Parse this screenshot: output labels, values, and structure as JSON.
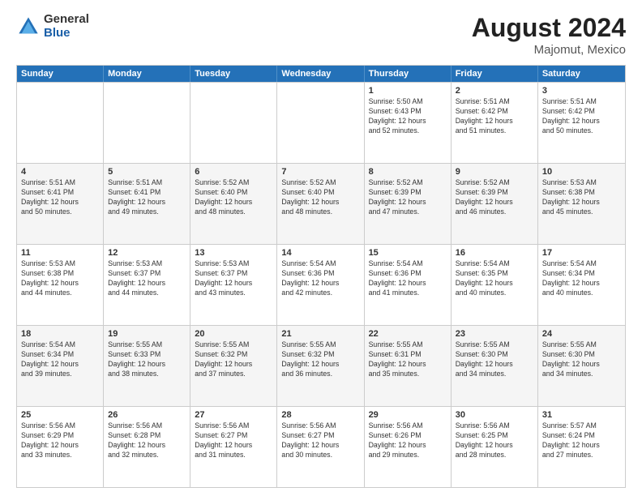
{
  "logo": {
    "general": "General",
    "blue": "Blue"
  },
  "header": {
    "month_year": "August 2024",
    "location": "Majomut, Mexico"
  },
  "weekdays": [
    "Sunday",
    "Monday",
    "Tuesday",
    "Wednesday",
    "Thursday",
    "Friday",
    "Saturday"
  ],
  "rows": [
    [
      {
        "day": "",
        "info": ""
      },
      {
        "day": "",
        "info": ""
      },
      {
        "day": "",
        "info": ""
      },
      {
        "day": "",
        "info": ""
      },
      {
        "day": "1",
        "info": "Sunrise: 5:50 AM\nSunset: 6:43 PM\nDaylight: 12 hours\nand 52 minutes."
      },
      {
        "day": "2",
        "info": "Sunrise: 5:51 AM\nSunset: 6:42 PM\nDaylight: 12 hours\nand 51 minutes."
      },
      {
        "day": "3",
        "info": "Sunrise: 5:51 AM\nSunset: 6:42 PM\nDaylight: 12 hours\nand 50 minutes."
      }
    ],
    [
      {
        "day": "4",
        "info": "Sunrise: 5:51 AM\nSunset: 6:41 PM\nDaylight: 12 hours\nand 50 minutes."
      },
      {
        "day": "5",
        "info": "Sunrise: 5:51 AM\nSunset: 6:41 PM\nDaylight: 12 hours\nand 49 minutes."
      },
      {
        "day": "6",
        "info": "Sunrise: 5:52 AM\nSunset: 6:40 PM\nDaylight: 12 hours\nand 48 minutes."
      },
      {
        "day": "7",
        "info": "Sunrise: 5:52 AM\nSunset: 6:40 PM\nDaylight: 12 hours\nand 48 minutes."
      },
      {
        "day": "8",
        "info": "Sunrise: 5:52 AM\nSunset: 6:39 PM\nDaylight: 12 hours\nand 47 minutes."
      },
      {
        "day": "9",
        "info": "Sunrise: 5:52 AM\nSunset: 6:39 PM\nDaylight: 12 hours\nand 46 minutes."
      },
      {
        "day": "10",
        "info": "Sunrise: 5:53 AM\nSunset: 6:38 PM\nDaylight: 12 hours\nand 45 minutes."
      }
    ],
    [
      {
        "day": "11",
        "info": "Sunrise: 5:53 AM\nSunset: 6:38 PM\nDaylight: 12 hours\nand 44 minutes."
      },
      {
        "day": "12",
        "info": "Sunrise: 5:53 AM\nSunset: 6:37 PM\nDaylight: 12 hours\nand 44 minutes."
      },
      {
        "day": "13",
        "info": "Sunrise: 5:53 AM\nSunset: 6:37 PM\nDaylight: 12 hours\nand 43 minutes."
      },
      {
        "day": "14",
        "info": "Sunrise: 5:54 AM\nSunset: 6:36 PM\nDaylight: 12 hours\nand 42 minutes."
      },
      {
        "day": "15",
        "info": "Sunrise: 5:54 AM\nSunset: 6:36 PM\nDaylight: 12 hours\nand 41 minutes."
      },
      {
        "day": "16",
        "info": "Sunrise: 5:54 AM\nSunset: 6:35 PM\nDaylight: 12 hours\nand 40 minutes."
      },
      {
        "day": "17",
        "info": "Sunrise: 5:54 AM\nSunset: 6:34 PM\nDaylight: 12 hours\nand 40 minutes."
      }
    ],
    [
      {
        "day": "18",
        "info": "Sunrise: 5:54 AM\nSunset: 6:34 PM\nDaylight: 12 hours\nand 39 minutes."
      },
      {
        "day": "19",
        "info": "Sunrise: 5:55 AM\nSunset: 6:33 PM\nDaylight: 12 hours\nand 38 minutes."
      },
      {
        "day": "20",
        "info": "Sunrise: 5:55 AM\nSunset: 6:32 PM\nDaylight: 12 hours\nand 37 minutes."
      },
      {
        "day": "21",
        "info": "Sunrise: 5:55 AM\nSunset: 6:32 PM\nDaylight: 12 hours\nand 36 minutes."
      },
      {
        "day": "22",
        "info": "Sunrise: 5:55 AM\nSunset: 6:31 PM\nDaylight: 12 hours\nand 35 minutes."
      },
      {
        "day": "23",
        "info": "Sunrise: 5:55 AM\nSunset: 6:30 PM\nDaylight: 12 hours\nand 34 minutes."
      },
      {
        "day": "24",
        "info": "Sunrise: 5:55 AM\nSunset: 6:30 PM\nDaylight: 12 hours\nand 34 minutes."
      }
    ],
    [
      {
        "day": "25",
        "info": "Sunrise: 5:56 AM\nSunset: 6:29 PM\nDaylight: 12 hours\nand 33 minutes."
      },
      {
        "day": "26",
        "info": "Sunrise: 5:56 AM\nSunset: 6:28 PM\nDaylight: 12 hours\nand 32 minutes."
      },
      {
        "day": "27",
        "info": "Sunrise: 5:56 AM\nSunset: 6:27 PM\nDaylight: 12 hours\nand 31 minutes."
      },
      {
        "day": "28",
        "info": "Sunrise: 5:56 AM\nSunset: 6:27 PM\nDaylight: 12 hours\nand 30 minutes."
      },
      {
        "day": "29",
        "info": "Sunrise: 5:56 AM\nSunset: 6:26 PM\nDaylight: 12 hours\nand 29 minutes."
      },
      {
        "day": "30",
        "info": "Sunrise: 5:56 AM\nSunset: 6:25 PM\nDaylight: 12 hours\nand 28 minutes."
      },
      {
        "day": "31",
        "info": "Sunrise: 5:57 AM\nSunset: 6:24 PM\nDaylight: 12 hours\nand 27 minutes."
      }
    ]
  ]
}
